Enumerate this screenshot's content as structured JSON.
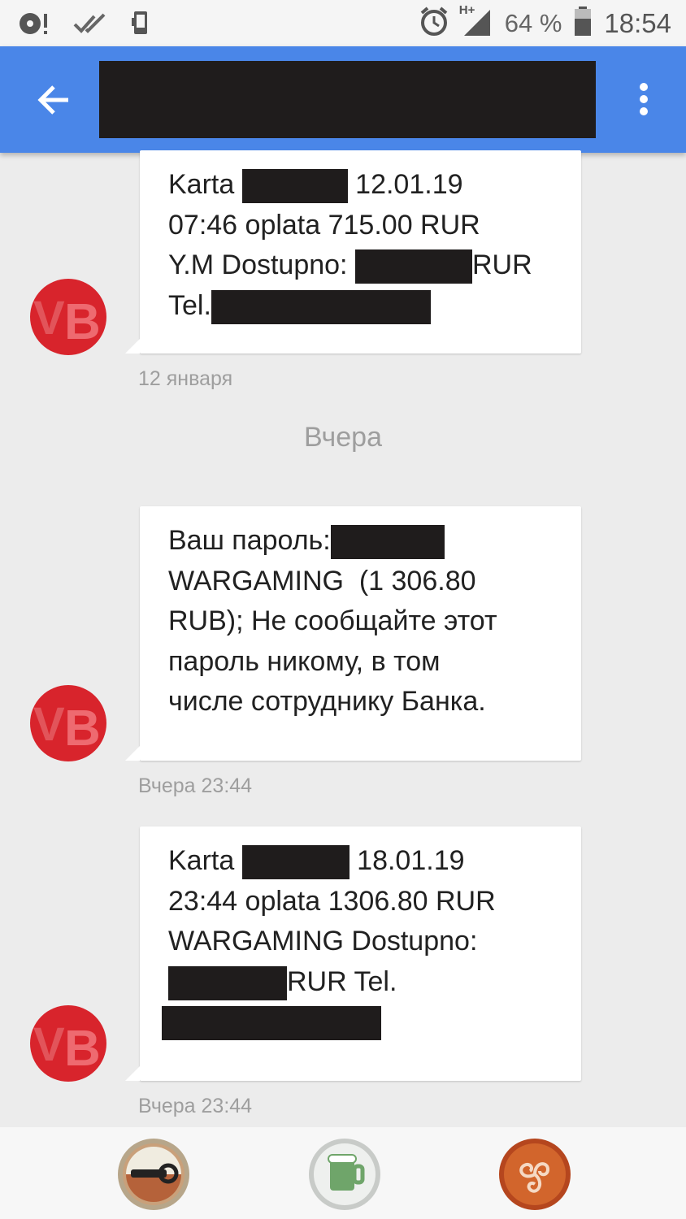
{
  "status_bar": {
    "battery_percent": "64 %",
    "network": "H+",
    "time": "18:54",
    "icons": [
      "disk-alert-icon",
      "double-check-icon",
      "phone-vibrate-icon",
      "alarm-icon",
      "signal-icon",
      "battery-icon"
    ]
  },
  "app_bar": {
    "back_icon": "arrow-back-icon",
    "menu_icon": "more-vert-icon"
  },
  "avatar": {
    "letters": "VB",
    "color": "#d8242c"
  },
  "messages": [
    {
      "lines": [
        [
          "Karta",
          "",
          "12.01.19"
        ],
        [
          "07:46 oplata 715.00 RUR"
        ],
        [
          "Y.M Dostupno:",
          "",
          "RUR"
        ],
        [
          "Tel.",
          ""
        ]
      ],
      "timestamp": "12 января"
    },
    {
      "day_separator": "Вчера",
      "lines": [
        [
          "Ваш пароль:",
          ""
        ],
        [
          "WARGAMING  (1 306.80"
        ],
        [
          "RUB); Не сообщайте этот"
        ],
        [
          "пароль никому, в том"
        ],
        [
          "числе сотруднику Банка."
        ]
      ],
      "timestamp": "Вчера 23:44"
    },
    {
      "lines": [
        [
          "Karta",
          "",
          "18.01.19"
        ],
        [
          "23:44 oplata 1306.80 RUR"
        ],
        [
          "WARGAMING Dostupno:"
        ],
        [
          "",
          "RUR Tel."
        ],
        [
          ""
        ]
      ],
      "timestamp": "Вчера 23:44"
    }
  ],
  "bottom_bar": {
    "caps": [
      "bottle-opener-cap-icon",
      "beer-mug-cap-icon",
      "triskelion-cap-icon"
    ]
  },
  "colors": {
    "app_bar": "#4a86e8",
    "background": "#ececec",
    "bubble": "#ffffff",
    "redaction": "#1f1c1c"
  }
}
